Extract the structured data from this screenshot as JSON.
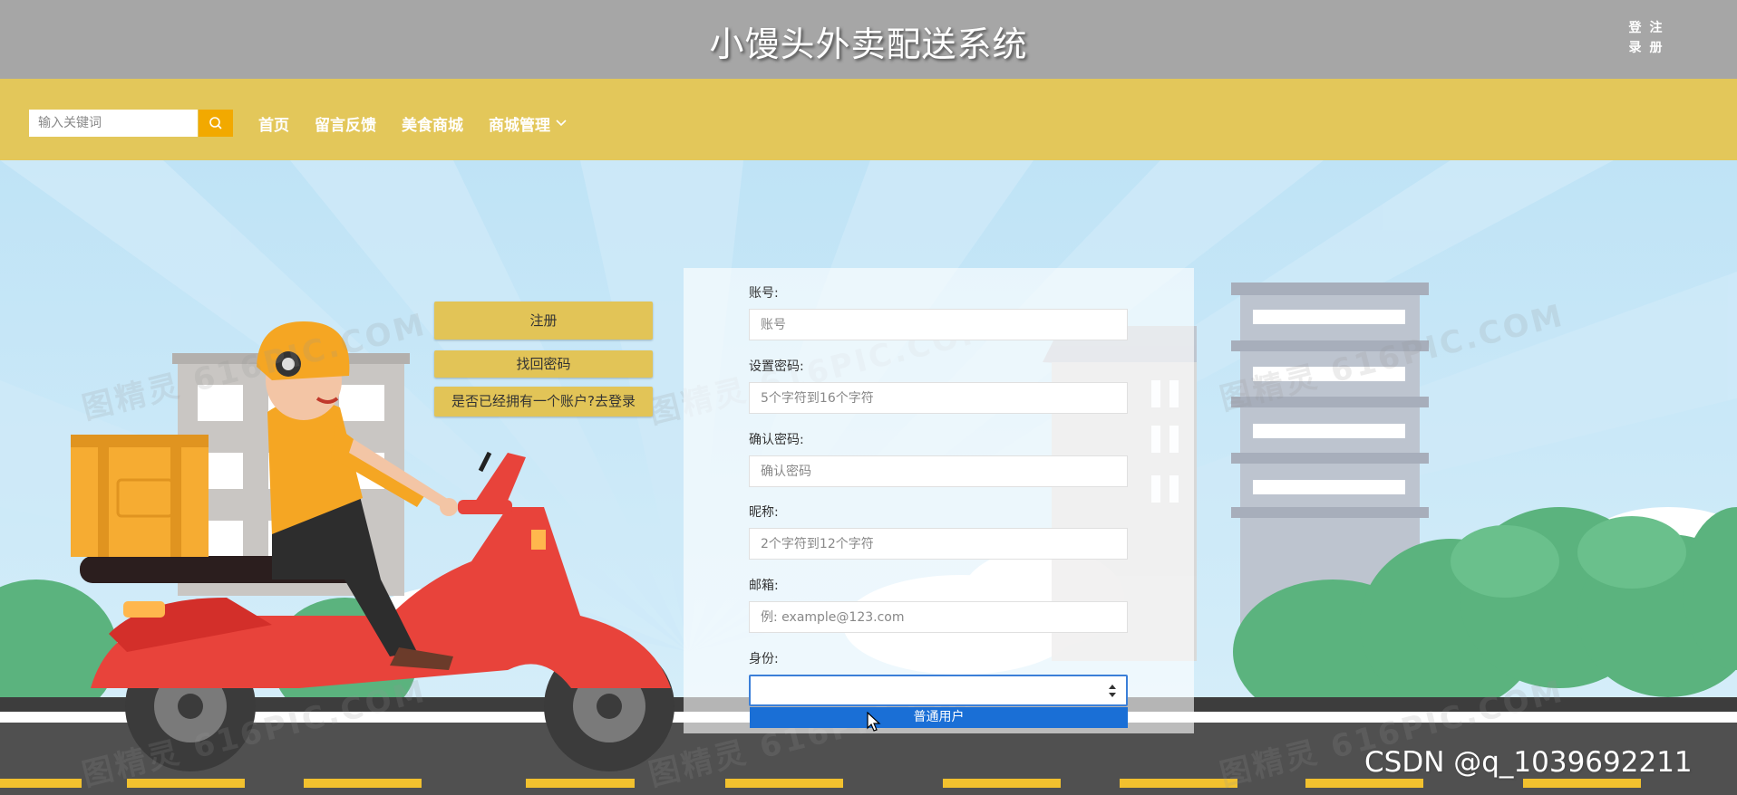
{
  "header": {
    "title": "小馒头外卖配送系统",
    "auth_links": [
      "登",
      "注",
      "录",
      "册"
    ]
  },
  "nav": {
    "search_placeholder": "输入关键词",
    "items": [
      {
        "label": "首页"
      },
      {
        "label": "留言反馈"
      },
      {
        "label": "美食商城"
      },
      {
        "label": "商城管理"
      }
    ]
  },
  "side_buttons": {
    "register": "注册",
    "recover_password": "找回密码",
    "have_account_login": "是否已经拥有一个账户?去登录"
  },
  "form": {
    "account": {
      "label": "账号:",
      "placeholder": "账号"
    },
    "password": {
      "label": "设置密码:",
      "placeholder": "5个字符到16个字符"
    },
    "confirm_password": {
      "label": "确认密码:",
      "placeholder": "确认密码"
    },
    "nickname": {
      "label": "昵称:",
      "placeholder": "2个字符到12个字符"
    },
    "email": {
      "label": "邮箱:",
      "placeholder": "例: example@123.com"
    },
    "role": {
      "label": "身份:",
      "value": "",
      "highlighted_option": "普通用户"
    }
  },
  "watermark_text": "图精灵 616PIC.COM",
  "footer_watermark": "CSDN @q_1039692211",
  "colors": {
    "title_bar": "#a6a6a6",
    "nav_bar": "#e3c75a",
    "search_button": "#f2a900",
    "side_button": "#e2c457",
    "option_highlight": "#1a6fd6"
  },
  "icons": {
    "search": "search-icon",
    "nav_dropdown": "chevron-down-icon",
    "select_arrows": "select-arrows-icon",
    "cursor": "mouse-cursor-icon"
  }
}
